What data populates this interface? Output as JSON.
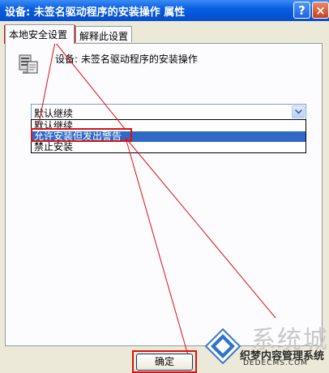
{
  "window": {
    "title": "设备: 未签名驱动程序的安装操作 属性",
    "help_label": "?",
    "close_label": "×"
  },
  "tabs": [
    {
      "label": "本地安全设置",
      "active": true
    },
    {
      "label": "解释此设置",
      "active": false
    }
  ],
  "setting": {
    "icon": "computer-policy-icon",
    "label": "设备: 未签名驱动程序的安装操作"
  },
  "combo": {
    "selected_value": "默认继续",
    "options": [
      "默认继续",
      "允许安装但发出警告",
      "禁止安装"
    ],
    "highlighted_option": "允许安装但发出警告"
  },
  "footer": {
    "ok_label": "确定"
  },
  "watermark": {
    "top_text": "系统城",
    "middle_text": "织梦内容管理系统",
    "bottom_text": "DEDECMS.COM"
  },
  "colors": {
    "titlebar": "#0455d8",
    "selection": "#316ac5",
    "annotation": "#e01010"
  }
}
